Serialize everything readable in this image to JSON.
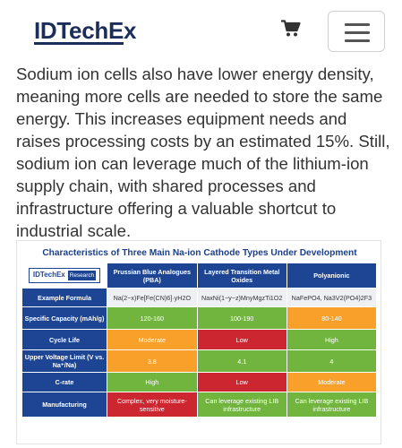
{
  "header": {
    "logo_text": "IDTechEx",
    "cart_icon": "shopping-cart-icon",
    "menu_icon": "hamburger-menu-icon"
  },
  "article": {
    "paragraph": "Sodium ion cells also have lower energy density, meaning more cells are needed to store the same energy. This increases equipment needs and raises processing costs by an estimated 15%. Still, sodium ion can leverage much of the lithium-ion supply chain, with shared processes and infrastructure offering a valuable shortcut to industrial scale."
  },
  "figure": {
    "title": "Characteristics of Three Main Na-ion Cathode Types Under Development",
    "brand": "IDTechEx",
    "brand_tag": "Research",
    "columns": [
      "Prussian Blue Analogues (PBA)",
      "Layered Transition Metal Oxides",
      "Polyanionic"
    ],
    "rows": [
      {
        "label": "Example Formula",
        "cells": [
          "Na(2−x)Fe[Fe(CN)6]·yH2O",
          "NaxNi(1−y−z)MnyMgzTi1O2",
          "NaFePO4, Na3V2(PO4)2F3"
        ],
        "colors": [
          "grey",
          "grey",
          "grey"
        ]
      },
      {
        "label": "Specific Capacity (mAh/g)",
        "cells": [
          "120-160",
          "100-190",
          "80-140"
        ],
        "colors": [
          "green",
          "green",
          "orange"
        ]
      },
      {
        "label": "Cycle Life",
        "cells": [
          "Moderate",
          "Low",
          "High"
        ],
        "colors": [
          "orange",
          "red",
          "green"
        ]
      },
      {
        "label": "Upper Voltage Limit (V vs. Na⁺/Na)",
        "cells": [
          "3.8",
          "4.1",
          "4"
        ],
        "colors": [
          "orange",
          "green",
          "green"
        ]
      },
      {
        "label": "C-rate",
        "cells": [
          "High",
          "Low",
          "Moderate"
        ],
        "colors": [
          "green",
          "red",
          "orange"
        ]
      },
      {
        "label": "Manufacturing",
        "cells": [
          "Complex, very moisture-sensitive",
          "Can leverage existing LIB infrastructure",
          "Can leverage existing LIB infrastructure"
        ],
        "colors": [
          "red",
          "green",
          "green"
        ]
      }
    ],
    "status_colors": {
      "green": "#71b53f",
      "orange": "#f9a02b",
      "red": "#cc2631",
      "header_blue": "#1e4594"
    }
  }
}
